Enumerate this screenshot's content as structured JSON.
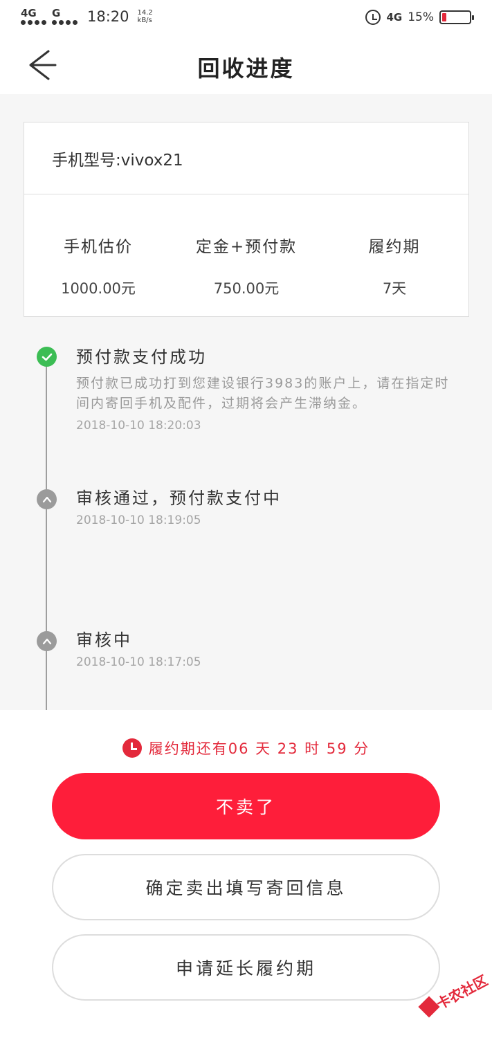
{
  "status_bar": {
    "sim1": "4G",
    "sim2": "G",
    "time": "18:20",
    "speed_value": "14.2",
    "speed_unit": "kB/s",
    "net_type": "4G",
    "battery_percent": "15%",
    "battery_level": 0.15
  },
  "header": {
    "back_icon": "arrow-left-icon",
    "title": "回收进度"
  },
  "info_card": {
    "model": "手机型号:vivox21",
    "stats": [
      {
        "label": "手机估价",
        "value": "1000.00元"
      },
      {
        "label": "定金+预付款",
        "value": "750.00元"
      },
      {
        "label": "履约期",
        "value": "7天"
      }
    ]
  },
  "timeline": [
    {
      "status": "done",
      "icon": "check-icon",
      "title": "预付款支付成功",
      "desc": "预付款已成功打到您建设银行3983的账户上，请在指定时间内寄回手机及配件，过期将会产生滞纳金。",
      "time": "2018-10-10 18:20:03"
    },
    {
      "status": "pending",
      "icon": "chevron-up-icon",
      "title": "审核通过，预付款支付中",
      "time": "2018-10-10 18:19:05"
    },
    {
      "status": "pending",
      "icon": "chevron-up-icon",
      "title": "审核中",
      "time": "2018-10-10 18:17:05"
    }
  ],
  "countdown": {
    "icon": "clock-icon",
    "text": "履约期还有06 天 23 时 59 分"
  },
  "buttons": {
    "cancel_sale": "不卖了",
    "confirm_sale": "确定卖出填写寄回信息",
    "extend_period": "申请延长履约期"
  },
  "watermark": {
    "text": "卡农社区"
  },
  "colors": {
    "accent_red": "#fe1e3a",
    "success_green": "#3cbd54",
    "pending_gray": "#9b9b9b"
  }
}
